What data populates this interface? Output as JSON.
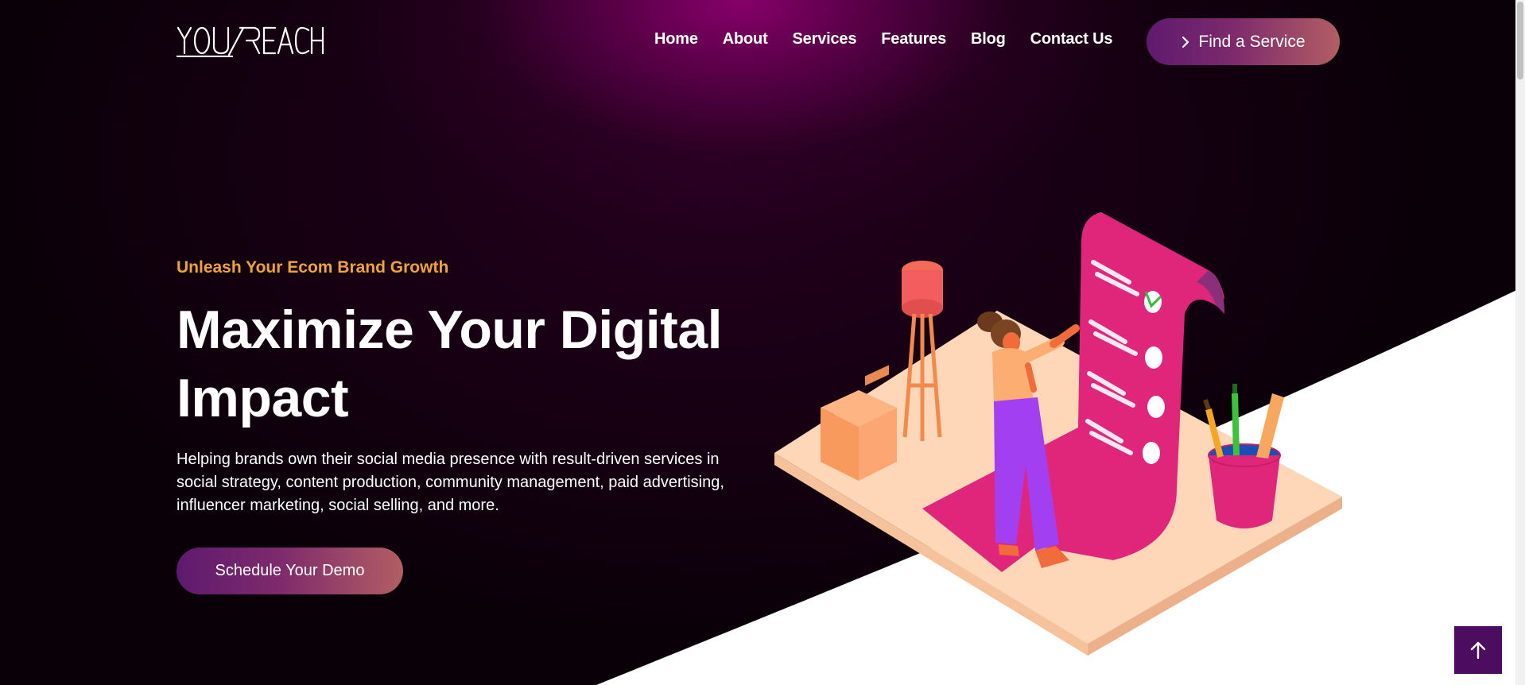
{
  "brand": {
    "logo_text": "YOU REACH"
  },
  "nav": {
    "items": [
      "Home",
      "About",
      "Services",
      "Features",
      "Blog",
      "Contact Us"
    ],
    "cta_label": "Find a Service"
  },
  "hero": {
    "tagline": "Unleash Your Ecom Brand Growth",
    "headline_line1": "Maximize Your Digital",
    "headline_line2": "Impact",
    "description": "Helping brands own their social media presence with result-driven services in social strategy, content production, community management, paid advertising, influencer marketing, social selling, and more.",
    "cta_label": "Schedule Your Demo"
  },
  "icons": {
    "cta_chevron": "chevron-right-icon",
    "back_to_top": "arrow-up-icon"
  },
  "colors": {
    "accent_orange": "#f1a33d",
    "button_gradient_start": "#5e1a6e",
    "button_gradient_end": "#b25e64",
    "back_to_top_bg": "#4c0c5f",
    "illustration_pink": "#e0267a"
  }
}
